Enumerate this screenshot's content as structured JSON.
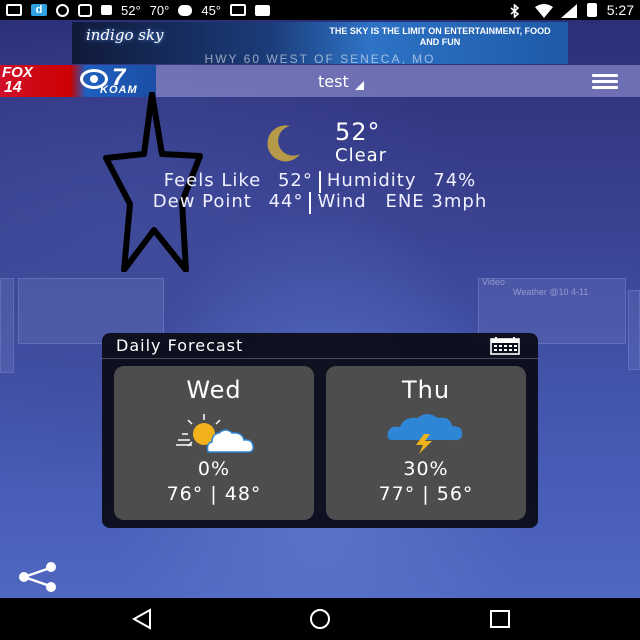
{
  "status_bar": {
    "temps": [
      "52°",
      "70°",
      "45°"
    ],
    "time": "5:27",
    "d_badge": "d"
  },
  "ad": {
    "logo": "indigo sky",
    "headline": "THE SKY IS THE LIMIT ON ENTERTAINMENT, FOOD AND FUN",
    "road_text": "HWY 60 WEST OF SENECA, MO"
  },
  "header": {
    "logo_fox": "FOX",
    "logo_fox_channel": "14",
    "logo_cbs_channel": "7",
    "logo_koam": "KOAM",
    "location": "test"
  },
  "current": {
    "temperature": "52°",
    "condition": "Clear",
    "feels_like_label": "Feels Like",
    "feels_like": "52°",
    "humidity_label": "Humidity",
    "humidity": "74%",
    "dew_point_label": "Dew Point",
    "dew_point": "44°",
    "wind_label": "Wind",
    "wind": "ENE 3mph"
  },
  "ghost_labels": [
    "Video",
    "Weather @10 4-11"
  ],
  "forecast": {
    "title": "Daily Forecast",
    "days": [
      {
        "day": "Wed",
        "icon": "partly-sunny-icon",
        "precip": "0%",
        "temps": "76° | 48°"
      },
      {
        "day": "Thu",
        "icon": "thunderstorm-icon",
        "precip": "30%",
        "temps": "77° | 56°"
      }
    ]
  },
  "colors": {
    "moon": "#b59a4a",
    "sun": "#f2b21b",
    "storm_cloud": "#2f86d6",
    "bolt": "#f0b21a",
    "card": "#4d4d4d"
  }
}
